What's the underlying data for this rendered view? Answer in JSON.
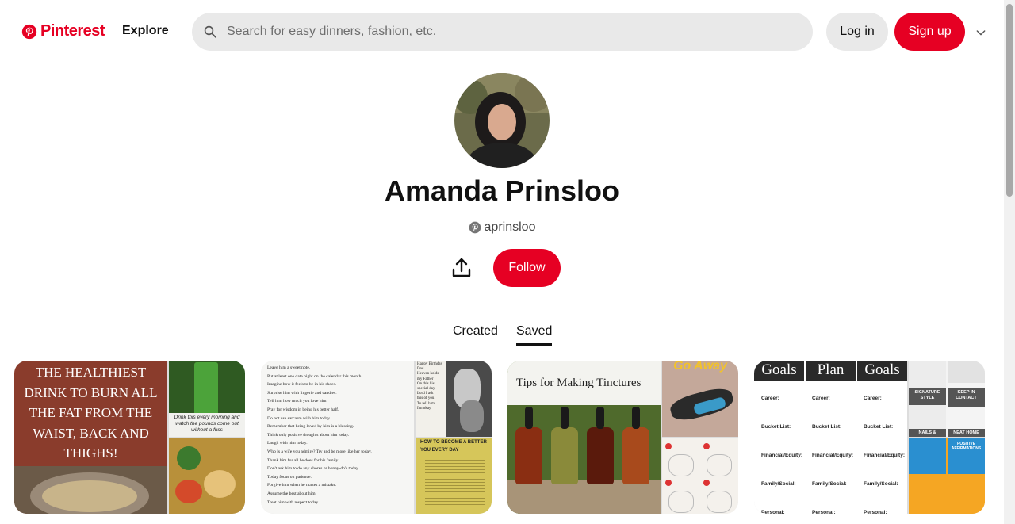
{
  "header": {
    "logo_text": "Pinterest",
    "explore_label": "Explore",
    "search_placeholder": "Search for easy dinners, fashion, etc.",
    "login_label": "Log in",
    "signup_label": "Sign up"
  },
  "profile": {
    "name": "Amanda Prinsloo",
    "handle": "aprinsloo",
    "follow_label": "Follow"
  },
  "tabs": {
    "created": "Created",
    "saved": "Saved"
  },
  "boards": {
    "b1": {
      "caption_lines": [
        "THE HEALTHIEST",
        "DRINK TO BURN ALL",
        "THE FAT FROM THE",
        "WAIST, BACK AND",
        "THIGHS!"
      ],
      "side_caption": "Drink this every morning and watch the pounds come out without a fuss"
    },
    "b2": {
      "list_lines": [
        "Leave him a sweet note.",
        "Put at least one date night on the calendar this month.",
        "Imagine how it feels to be in his shoes.",
        "Surprise him with lingerie and candles.",
        "Tell him how much you love him.",
        "Pray for wisdom in being his better half.",
        "Do not use sarcasm with him today.",
        "Remember that being loved by him is a blessing.",
        "Think only positive thoughts about him today.",
        "Laugh with him today.",
        "Who is a wife you admire? Try and be more like her today.",
        "Thank him for all he does for his family.",
        "Don't ask him to do any chores or honey-do's today.",
        "Today focus on patience.",
        "Forgive him when he makes a mistake.",
        "Assume the best about him.",
        "Treat him with respect today."
      ],
      "poem_title": "Happy Birthday Dad",
      "poem_lines": [
        "Heaven holds",
        "my Father",
        "On this his",
        "special day",
        "Lord I ask",
        "this of you",
        "To tell him",
        "I'm okay"
      ],
      "better_title": "HOW TO BECOME A BETTER YOU EVERY DAY"
    },
    "b3": {
      "title": "Tips for Making Tinctures",
      "side_title": "Go Away"
    },
    "b4": {
      "headers": [
        "Goals",
        "Plan",
        "Goals"
      ],
      "rows": [
        "Career:",
        "Bucket List:",
        "Financial/Equity:",
        "Family/Social:",
        "Personal:"
      ],
      "side_labels": [
        "SIGNATURE STYLE",
        "KEEP IN CONTACT",
        "NAILS &",
        "NEAT HOME",
        "POSITIVE AFFIRMATIONS"
      ]
    }
  },
  "colors": {
    "brand": "#e60023",
    "button_gray": "#e9e9e9"
  },
  "icons": {
    "logo": "pinterest-logo-icon",
    "search": "search-icon",
    "chevron": "chevron-down-icon",
    "share": "share-icon",
    "handle": "pinterest-small-icon"
  }
}
